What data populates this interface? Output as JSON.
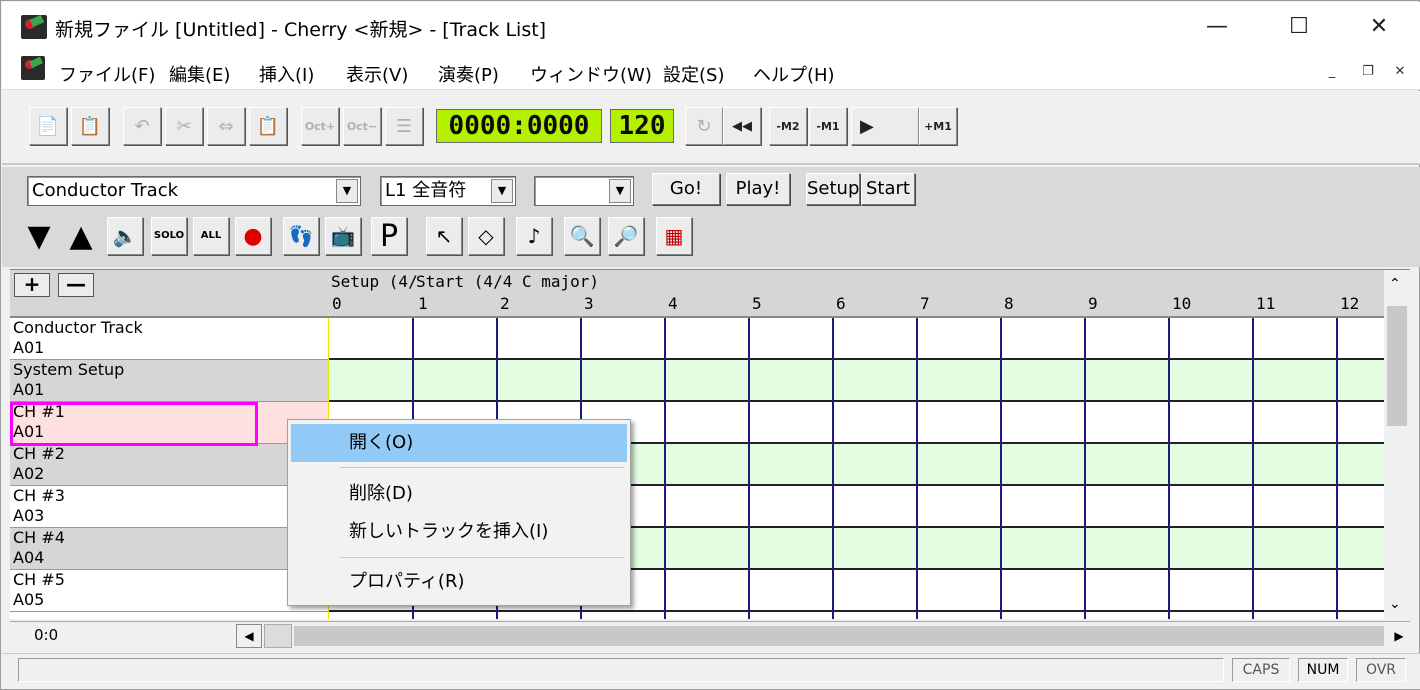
{
  "window": {
    "title": "新規ファイル [Untitled] - Cherry <新規>  - [Track List]",
    "minimize": "—",
    "maximize": "☐",
    "close": "✕"
  },
  "menu": [
    "ファイル(F)",
    "編集(E)",
    "挿入(I)",
    "表示(V)",
    "演奏(P)",
    "ウィンドウ(W)",
    "設定(S)",
    "ヘルプ(H)"
  ],
  "mdi": {
    "minimize": "_",
    "restore": "❐",
    "close": "✕"
  },
  "toolbar": {
    "oct_up": "Oct+",
    "oct_down": "Oct−",
    "counter": "0000:0000",
    "tempo": "120",
    "rewind": "◀◀",
    "m2": "-M2",
    "m1": "-M1",
    "play": "▶",
    "p1": "+M1"
  },
  "controls": {
    "track_select": "Conductor Track",
    "length_select": "L1 全音符",
    "blank_select": "",
    "go": "Go!",
    "play": "Play!",
    "setup": "Setup",
    "start": "Start",
    "solo": "SOLO",
    "all": "ALL",
    "p": "P"
  },
  "tracklist": {
    "plus": "+",
    "minus": "—",
    "ruler_label_setup": "Setup (4/",
    "ruler_label_start": "Start (4/4 C major)",
    "measures": [
      "0",
      "1",
      "2",
      "3",
      "4",
      "5",
      "6",
      "7",
      "8",
      "9",
      "10",
      "11",
      "12"
    ],
    "tracks": [
      {
        "name": "Conductor Track",
        "port": "A01",
        "bg": "#ffffff",
        "lane": "#ffffff"
      },
      {
        "name": "System Setup",
        "port": "A01",
        "bg": "#d6d6d6",
        "lane": "#e3fde3"
      },
      {
        "name": "CH #1",
        "port": "A01",
        "bg": "#ffe0e0",
        "lane": "#ffffff"
      },
      {
        "name": "CH #2",
        "port": "A02",
        "bg": "#d6d6d6",
        "lane": "#e3fde3"
      },
      {
        "name": "CH #3",
        "port": "A03",
        "bg": "#ffffff",
        "lane": "#ffffff"
      },
      {
        "name": "CH #4",
        "port": "A04",
        "bg": "#d6d6d6",
        "lane": "#e3fde3"
      },
      {
        "name": "CH #5",
        "port": "A05",
        "bg": "#ffffff",
        "lane": "#ffffff"
      }
    ]
  },
  "position": "0:0",
  "status": {
    "caps": "CAPS",
    "num": "NUM",
    "ovr": "OVR"
  },
  "context_menu": {
    "open": "開く(O)",
    "delete": "削除(D)",
    "insert_track": "新しいトラックを挿入(I)",
    "properties": "プロパティ(R)"
  },
  "colors": {
    "lcd": "#b5f000",
    "highlight": "#91c9f7",
    "selection": "#ff00ff"
  }
}
